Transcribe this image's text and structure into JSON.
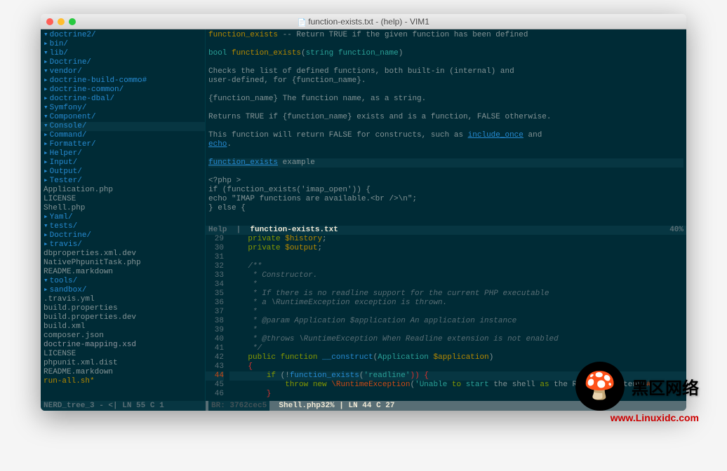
{
  "title": "function-exists.txt - (help) - VIM1",
  "tree": [
    {
      "depth": 0,
      "caret": "▾",
      "type": "dir",
      "text": "doctrine2/"
    },
    {
      "depth": 1,
      "caret": "▸",
      "type": "dir",
      "text": "bin/"
    },
    {
      "depth": 1,
      "caret": "▾",
      "type": "dir",
      "text": "lib/"
    },
    {
      "depth": 2,
      "caret": "▸",
      "type": "dir",
      "text": "Doctrine/"
    },
    {
      "depth": 2,
      "caret": "▾",
      "type": "dir",
      "text": "vendor/"
    },
    {
      "depth": 3,
      "caret": "▸",
      "type": "dir",
      "text": "doctrine-build-commo#"
    },
    {
      "depth": 3,
      "caret": "▸",
      "type": "dir",
      "text": "doctrine-common/"
    },
    {
      "depth": 3,
      "caret": "▸",
      "type": "dir",
      "text": "doctrine-dbal/"
    },
    {
      "depth": 3,
      "caret": "▾",
      "type": "dir",
      "text": "Symfony/"
    },
    {
      "depth": 4,
      "caret": "▾",
      "type": "dir",
      "text": "Component/"
    },
    {
      "depth": 5,
      "caret": "▾",
      "type": "dir",
      "text": "Console/",
      "hl": true
    },
    {
      "depth": 6,
      "caret": "▸",
      "type": "dir",
      "text": "Command/"
    },
    {
      "depth": 6,
      "caret": "▸",
      "type": "dir",
      "text": "Formatter/"
    },
    {
      "depth": 6,
      "caret": "▸",
      "type": "dir",
      "text": "Helper/"
    },
    {
      "depth": 6,
      "caret": "▸",
      "type": "dir",
      "text": "Input/"
    },
    {
      "depth": 6,
      "caret": "▸",
      "type": "dir",
      "text": "Output/"
    },
    {
      "depth": 6,
      "caret": "▸",
      "type": "dir",
      "text": "Tester/"
    },
    {
      "depth": 6,
      "caret": "",
      "type": "file",
      "text": "Application.php"
    },
    {
      "depth": 6,
      "caret": "",
      "type": "file",
      "text": "LICENSE"
    },
    {
      "depth": 6,
      "caret": "",
      "type": "file",
      "text": "Shell.php"
    },
    {
      "depth": 4,
      "caret": "▸",
      "type": "dir",
      "text": "Yaml/"
    },
    {
      "depth": 1,
      "caret": "▾",
      "type": "dir",
      "text": "tests/"
    },
    {
      "depth": 2,
      "caret": "▸",
      "type": "dir",
      "text": "Doctrine/"
    },
    {
      "depth": 2,
      "caret": "▸",
      "type": "dir",
      "text": "travis/"
    },
    {
      "depth": 2,
      "caret": "",
      "type": "file",
      "text": "dbproperties.xml.dev"
    },
    {
      "depth": 2,
      "caret": "",
      "type": "file",
      "text": "NativePhpunitTask.php"
    },
    {
      "depth": 2,
      "caret": "",
      "type": "file",
      "text": "README.markdown"
    },
    {
      "depth": 1,
      "caret": "▾",
      "type": "dir",
      "text": "tools/"
    },
    {
      "depth": 2,
      "caret": "▸",
      "type": "dir",
      "text": "sandbox/"
    },
    {
      "depth": 1,
      "caret": "",
      "type": "file",
      "text": ".travis.yml"
    },
    {
      "depth": 1,
      "caret": "",
      "type": "file",
      "text": "build.properties"
    },
    {
      "depth": 1,
      "caret": "",
      "type": "file",
      "text": "build.properties.dev"
    },
    {
      "depth": 1,
      "caret": "",
      "type": "file",
      "text": "build.xml"
    },
    {
      "depth": 1,
      "caret": "",
      "type": "file",
      "text": "composer.json"
    },
    {
      "depth": 1,
      "caret": "",
      "type": "rofile",
      "text": "doctrine-mapping.xsd"
    },
    {
      "depth": 1,
      "caret": "",
      "type": "file",
      "text": "LICENSE"
    },
    {
      "depth": 1,
      "caret": "",
      "type": "file",
      "text": "phpunit.xml.dist"
    },
    {
      "depth": 1,
      "caret": "",
      "type": "file",
      "text": "README.markdown"
    },
    {
      "depth": 1,
      "caret": "",
      "type": "star",
      "text": "run-all.sh*"
    }
  ],
  "left_status": {
    "name": "NERD_tree_3",
    "flag": "- <",
    "ln": "LN   55",
    "col": "C  1"
  },
  "help_header": "function_exists -- Return TRUE if the given function has been defined",
  "help_signature": {
    "type": "bool",
    "name": "function_exists",
    "args": "string function_name"
  },
  "help_body": {
    "p1a": "Checks the list of defined functions, both built-in (internal) and",
    "p1b": "user-defined, for {function_name}.",
    "p2": "{function_name} The function name, as a string.",
    "p3": "Returns TRUE if {function_name} exists and is a function, FALSE otherwise.",
    "p4a": "This function will return FALSE for constructs, such as ",
    "p4link1": "include_once",
    "p4mid": " and",
    "p4link2": "echo",
    "p4end": ".",
    "p5link": "function_exists",
    "p5": " example",
    "p6": "<?php >",
    "p7": "  if (function_exists('imap_open')) {",
    "p8": "      echo \"IMAP functions are available.<br />\\n\";",
    "p9": "  } else {"
  },
  "help_status": {
    "left": "Help",
    "sep": "|",
    "file": "function-exists.txt",
    "pct": "40%"
  },
  "code_lines": [
    {
      "n": 29,
      "tokens": [
        [
          "    ",
          ""
        ],
        [
          "private",
          "c-kw"
        ],
        [
          " ",
          ""
        ],
        [
          "$history",
          "c-var"
        ],
        [
          ";",
          ""
        ]
      ]
    },
    {
      "n": 30,
      "tokens": [
        [
          "    ",
          ""
        ],
        [
          "private",
          "c-kw"
        ],
        [
          " ",
          ""
        ],
        [
          "$output",
          "c-var"
        ],
        [
          ";",
          ""
        ]
      ]
    },
    {
      "n": 31,
      "tokens": [
        [
          "",
          ""
        ]
      ]
    },
    {
      "n": 32,
      "tokens": [
        [
          "    /**",
          "c-comm"
        ]
      ]
    },
    {
      "n": 33,
      "tokens": [
        [
          "     * Constructor.",
          "c-comm"
        ]
      ]
    },
    {
      "n": 34,
      "tokens": [
        [
          "     *",
          "c-comm"
        ]
      ]
    },
    {
      "n": 35,
      "tokens": [
        [
          "     * If there is no readline support for the current PHP executable",
          "c-comm"
        ]
      ]
    },
    {
      "n": 36,
      "tokens": [
        [
          "     * a \\RuntimeException exception is thrown.",
          "c-comm"
        ]
      ]
    },
    {
      "n": 37,
      "tokens": [
        [
          "     *",
          "c-comm"
        ]
      ]
    },
    {
      "n": 38,
      "tokens": [
        [
          "     * @param Application $application An application instance",
          "c-comm"
        ]
      ]
    },
    {
      "n": 39,
      "tokens": [
        [
          "     *",
          "c-comm"
        ]
      ]
    },
    {
      "n": 40,
      "tokens": [
        [
          "     * @throws \\RuntimeException When Readline extension is not enabled",
          "c-comm"
        ]
      ]
    },
    {
      "n": 41,
      "tokens": [
        [
          "     */",
          "c-comm"
        ]
      ]
    },
    {
      "n": 42,
      "tokens": [
        [
          "    ",
          ""
        ],
        [
          "public",
          "c-kw"
        ],
        [
          " ",
          ""
        ],
        [
          "function",
          "c-kw"
        ],
        [
          " ",
          ""
        ],
        [
          "__construct",
          "c-type"
        ],
        [
          "(",
          ""
        ],
        [
          "Application ",
          "c-func"
        ],
        [
          "$application",
          "c-var"
        ],
        [
          ")",
          ""
        ]
      ]
    },
    {
      "n": 43,
      "tokens": [
        [
          "    {",
          "c-red"
        ]
      ]
    },
    {
      "n": 44,
      "cursor": true,
      "tokens": [
        [
          "        ",
          ""
        ],
        [
          "if",
          "c-kw"
        ],
        [
          " (!",
          ""
        ],
        [
          "function_exists",
          "c-type"
        ],
        [
          "(",
          ""
        ],
        [
          "'readline'",
          "c-str"
        ],
        [
          ")) {",
          "c-red"
        ]
      ]
    },
    {
      "n": 45,
      "tokens": [
        [
          "            ",
          ""
        ],
        [
          "throw",
          "c-kw"
        ],
        [
          " ",
          ""
        ],
        [
          "new",
          "c-kw"
        ],
        [
          " ",
          ""
        ],
        [
          "\\RuntimeException",
          "c-orange"
        ],
        [
          "(",
          ""
        ],
        [
          "'Unable ",
          "c-str"
        ],
        [
          "to",
          "c-kw"
        ],
        [
          " start ",
          "c-str"
        ],
        [
          "the shell ",
          ""
        ],
        [
          "as",
          "c-kw"
        ],
        [
          " the Readline extensi",
          ""
        ],
        [
          "#",
          "c-orange"
        ]
      ]
    },
    {
      "n": 46,
      "tokens": [
        [
          "        }",
          "c-red"
        ]
      ]
    }
  ],
  "right_status": {
    "br": "BR: 3762cec5",
    "file": "Shell.php",
    "pct": "32%",
    "ln": "LN   44",
    "col": "C 27"
  },
  "watermark": {
    "text1": "黑区网络",
    "text2": "www.Linuxidc.com"
  }
}
